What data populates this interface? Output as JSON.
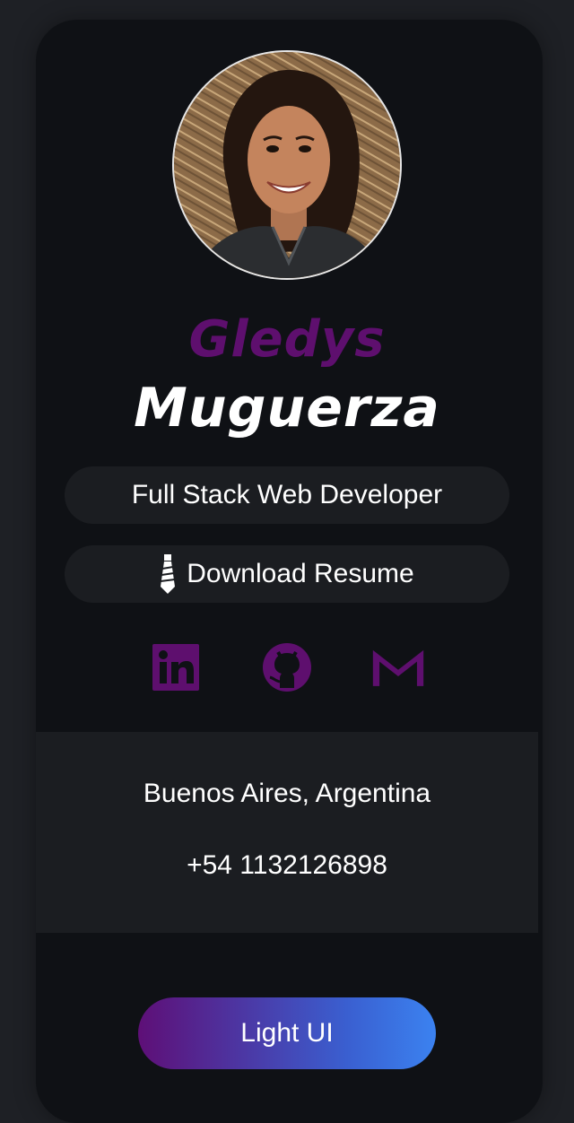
{
  "profile": {
    "first_name": "Gledys",
    "last_name": "Muguerza",
    "title": "Full Stack Web Developer",
    "resume_label": "Download Resume"
  },
  "socials": [
    {
      "name": "linkedin",
      "icon": "linkedin-icon"
    },
    {
      "name": "github",
      "icon": "github-icon"
    },
    {
      "name": "gmail",
      "icon": "gmail-icon"
    }
  ],
  "contact": {
    "location": "Buenos Aires, Argentina",
    "phone": "+54 1132126898"
  },
  "theme_toggle": {
    "label": "Light UI"
  },
  "colors": {
    "accent": "#5e0f6e",
    "card_bg": "#0f1115",
    "page_bg": "#1e2025",
    "pill_bg": "#1b1d21",
    "gradient_start": "#5e0f77",
    "gradient_end": "#3b82f0"
  }
}
